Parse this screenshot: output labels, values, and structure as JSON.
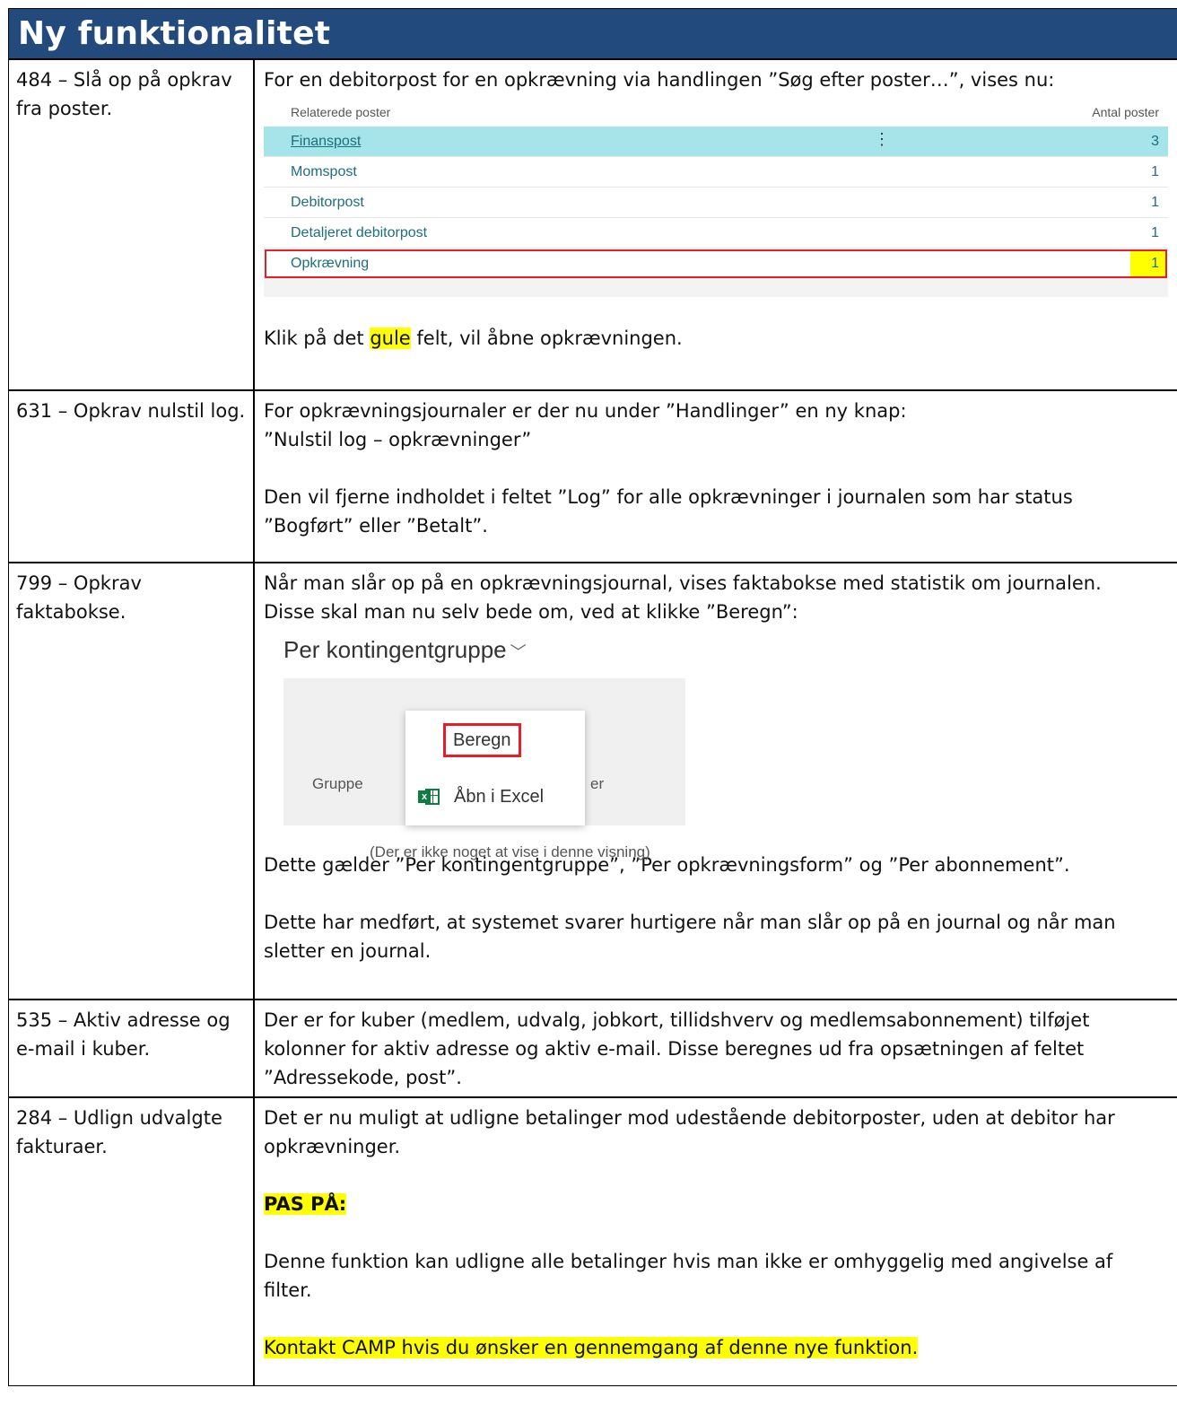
{
  "title": "Ny funktionalitet",
  "rows": [
    {
      "id": "484 – Slå op på opkrav fra poster.",
      "intro": "For en debitorpost for en opkrævning via handlingen ”Søg efter poster…”, vises nu:",
      "related": {
        "col_name": "Relaterede poster",
        "col_count": "Antal poster",
        "items": [
          {
            "name": "Finanspost",
            "count": "3"
          },
          {
            "name": "Momspost",
            "count": "1"
          },
          {
            "name": "Debitorpost",
            "count": "1"
          },
          {
            "name": "Detaljeret debitorpost",
            "count": "1"
          },
          {
            "name": "Opkrævning",
            "count": "1"
          }
        ]
      },
      "outro_pre": "Klik på det ",
      "outro_hl": "gule",
      "outro_post": " felt, vil åbne opkrævningen."
    },
    {
      "id": "631 – Opkrav nulstil log.",
      "line1": "For opkrævningsjournaler er der nu under ”Handlinger” en ny knap:",
      "line2": "”Nulstil log – opkrævninger”",
      "line3": "Den vil fjerne indholdet i feltet ”Log” for alle opkrævninger i journalen som har status",
      "line4": "”Bogført” eller ”Betalt”."
    },
    {
      "id": "799 – Opkrav faktabokse.",
      "line1": "Når man slår op på en opkrævningsjournal, vises faktabokse med statistik om journalen.",
      "line2": "Disse skal man nu selv bede om, ved at klikke ”Beregn”:",
      "factbox": {
        "title": "Per kontingentgruppe",
        "chevron": "﹀",
        "gruppe": "Gruppe",
        "er": "er",
        "empty": "(Der er ikke noget at vise i denne visning)",
        "menu_beregn": "Beregn",
        "menu_excel": "Åbn i Excel"
      },
      "line3": "Dette gælder ”Per kontingentgruppe”, ”Per opkrævningsform” og ”Per abonnement”.",
      "line4": "Dette har medført, at systemet svarer hurtigere når man slår op på en journal og når man",
      "line5": "sletter en journal."
    },
    {
      "id": "535 – Aktiv adresse og e-mail i kuber.",
      "line1": "Der er for kuber (medlem, udvalg, jobkort, tillidshverv og medlemsabonnement) tilføjet",
      "line2": "kolonner for aktiv adresse og aktiv e-mail. Disse beregnes ud fra opsætningen af feltet",
      "line3": "”Adressekode, post”."
    },
    {
      "id": "284 – Udlign udvalgte fakturaer.",
      "line1": "Det er nu muligt at udligne betalinger mod udestående debitorposter, uden at debitor har",
      "line2": "opkrævninger.",
      "warn": "PAS PÅ:",
      "line3": "Denne funktion kan udligne alle betalinger hvis man ikke er omhyggelig med angivelse af",
      "line4": "filter.",
      "contact": "Kontakt CAMP hvis du ønsker en gennemgang af denne nye funktion."
    }
  ]
}
